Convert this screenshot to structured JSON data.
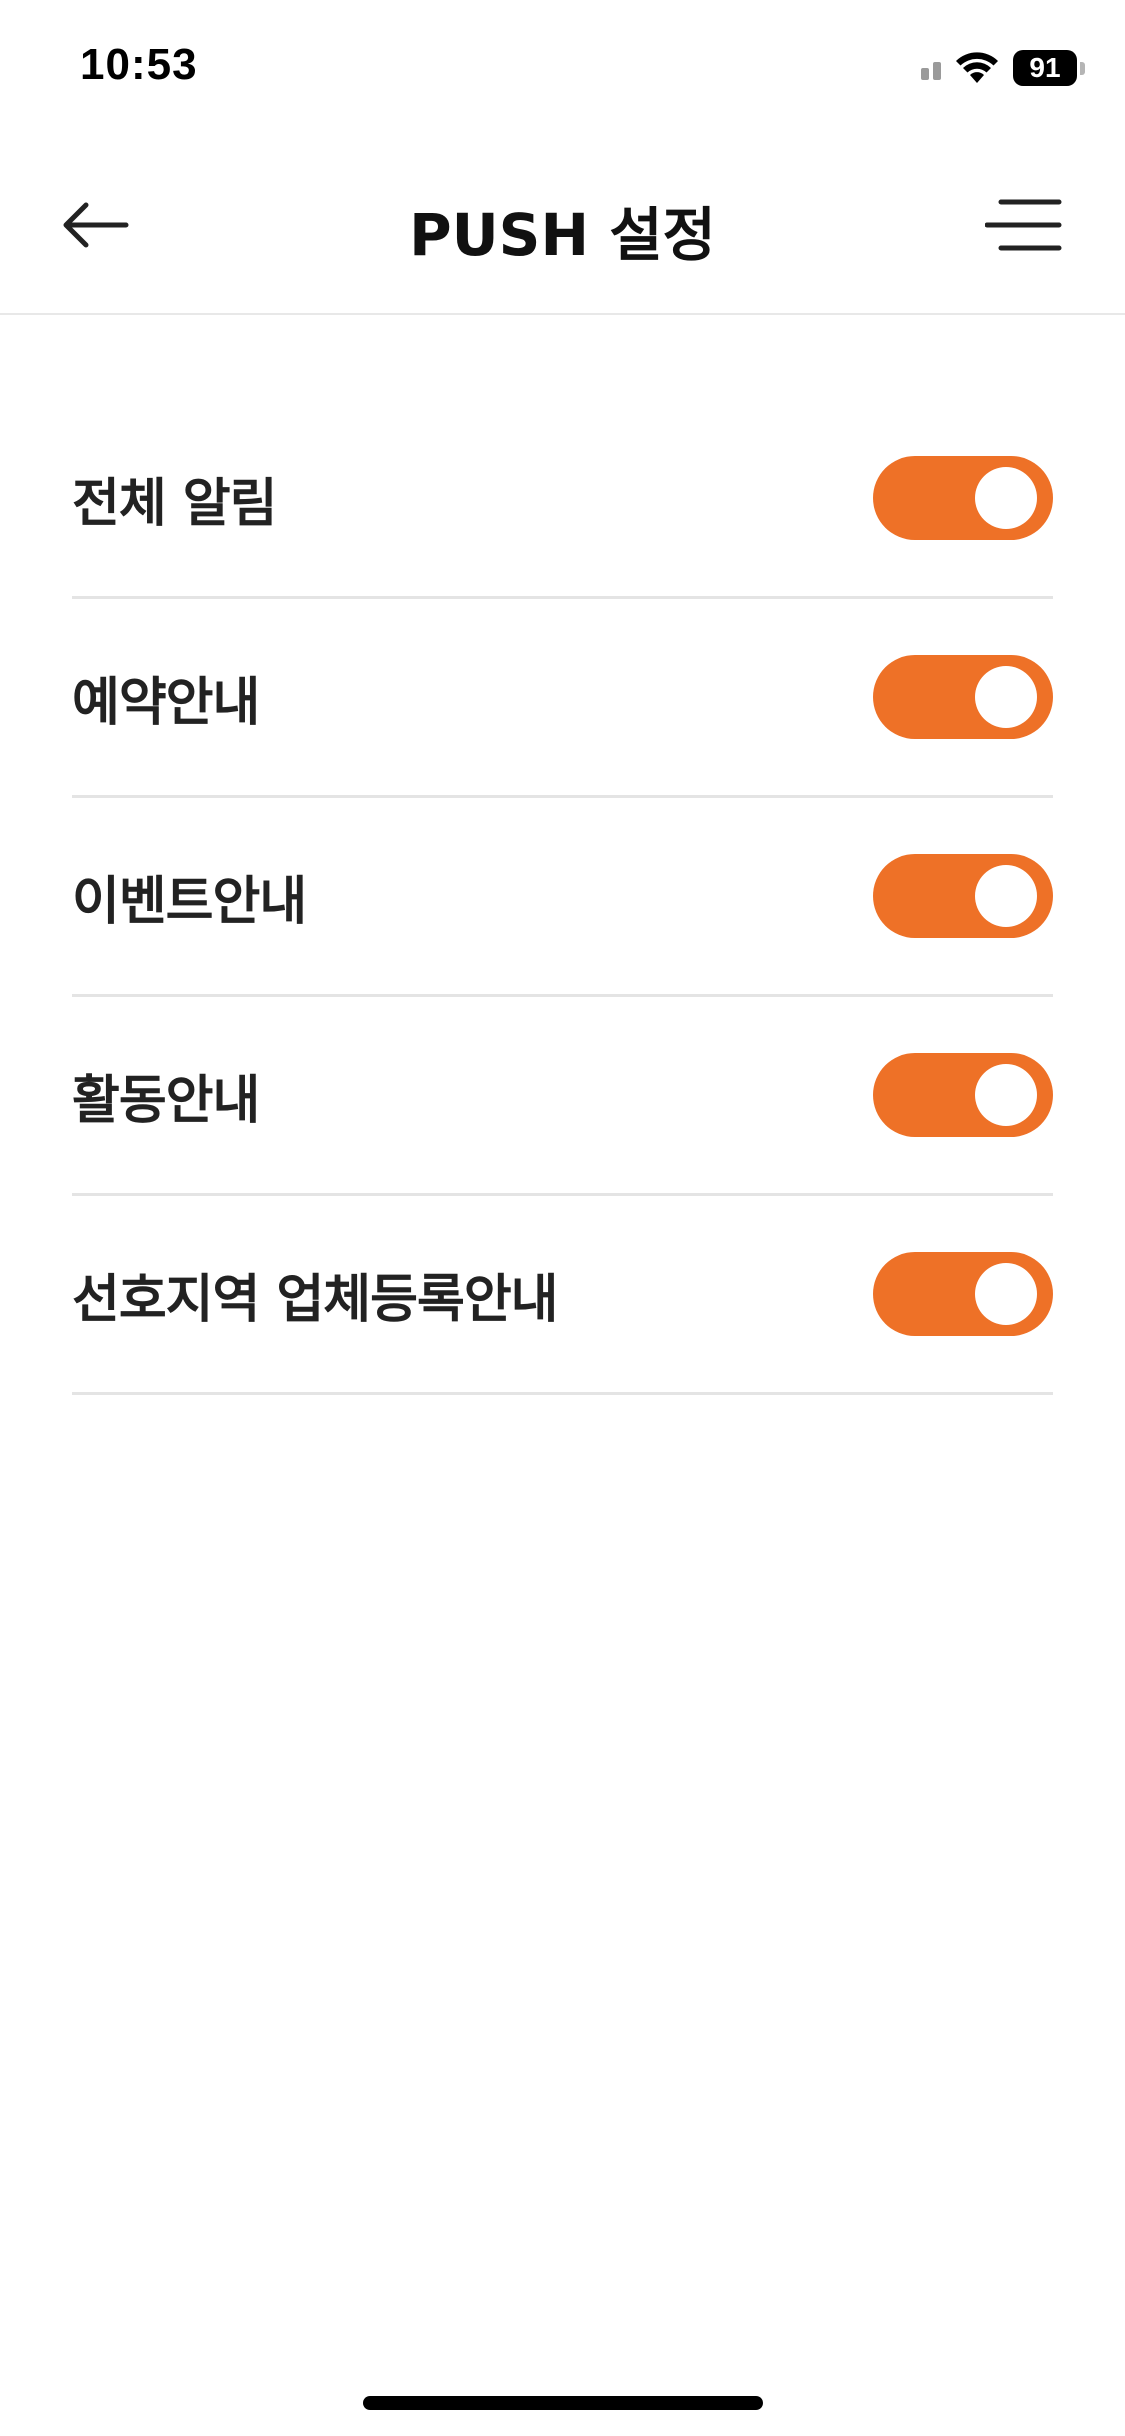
{
  "status_bar": {
    "time": "10:53",
    "battery_level": "91",
    "signal_icon": "cellular-signal-icon",
    "wifi_icon": "wifi-icon"
  },
  "header": {
    "title": "PUSH 설정",
    "back_icon": "arrow-left-icon",
    "menu_icon": "menu-icon"
  },
  "settings": [
    {
      "label": "전체 알림",
      "enabled": true
    },
    {
      "label": "예약안내",
      "enabled": true
    },
    {
      "label": "이벤트안내",
      "enabled": true
    },
    {
      "label": "활동안내",
      "enabled": true
    },
    {
      "label": "선호지역 업체등록안내",
      "enabled": true
    }
  ],
  "colors": {
    "accent": "#EE7127",
    "toggle_off": "#D9D9D9",
    "divider": "#E4E4E4"
  }
}
